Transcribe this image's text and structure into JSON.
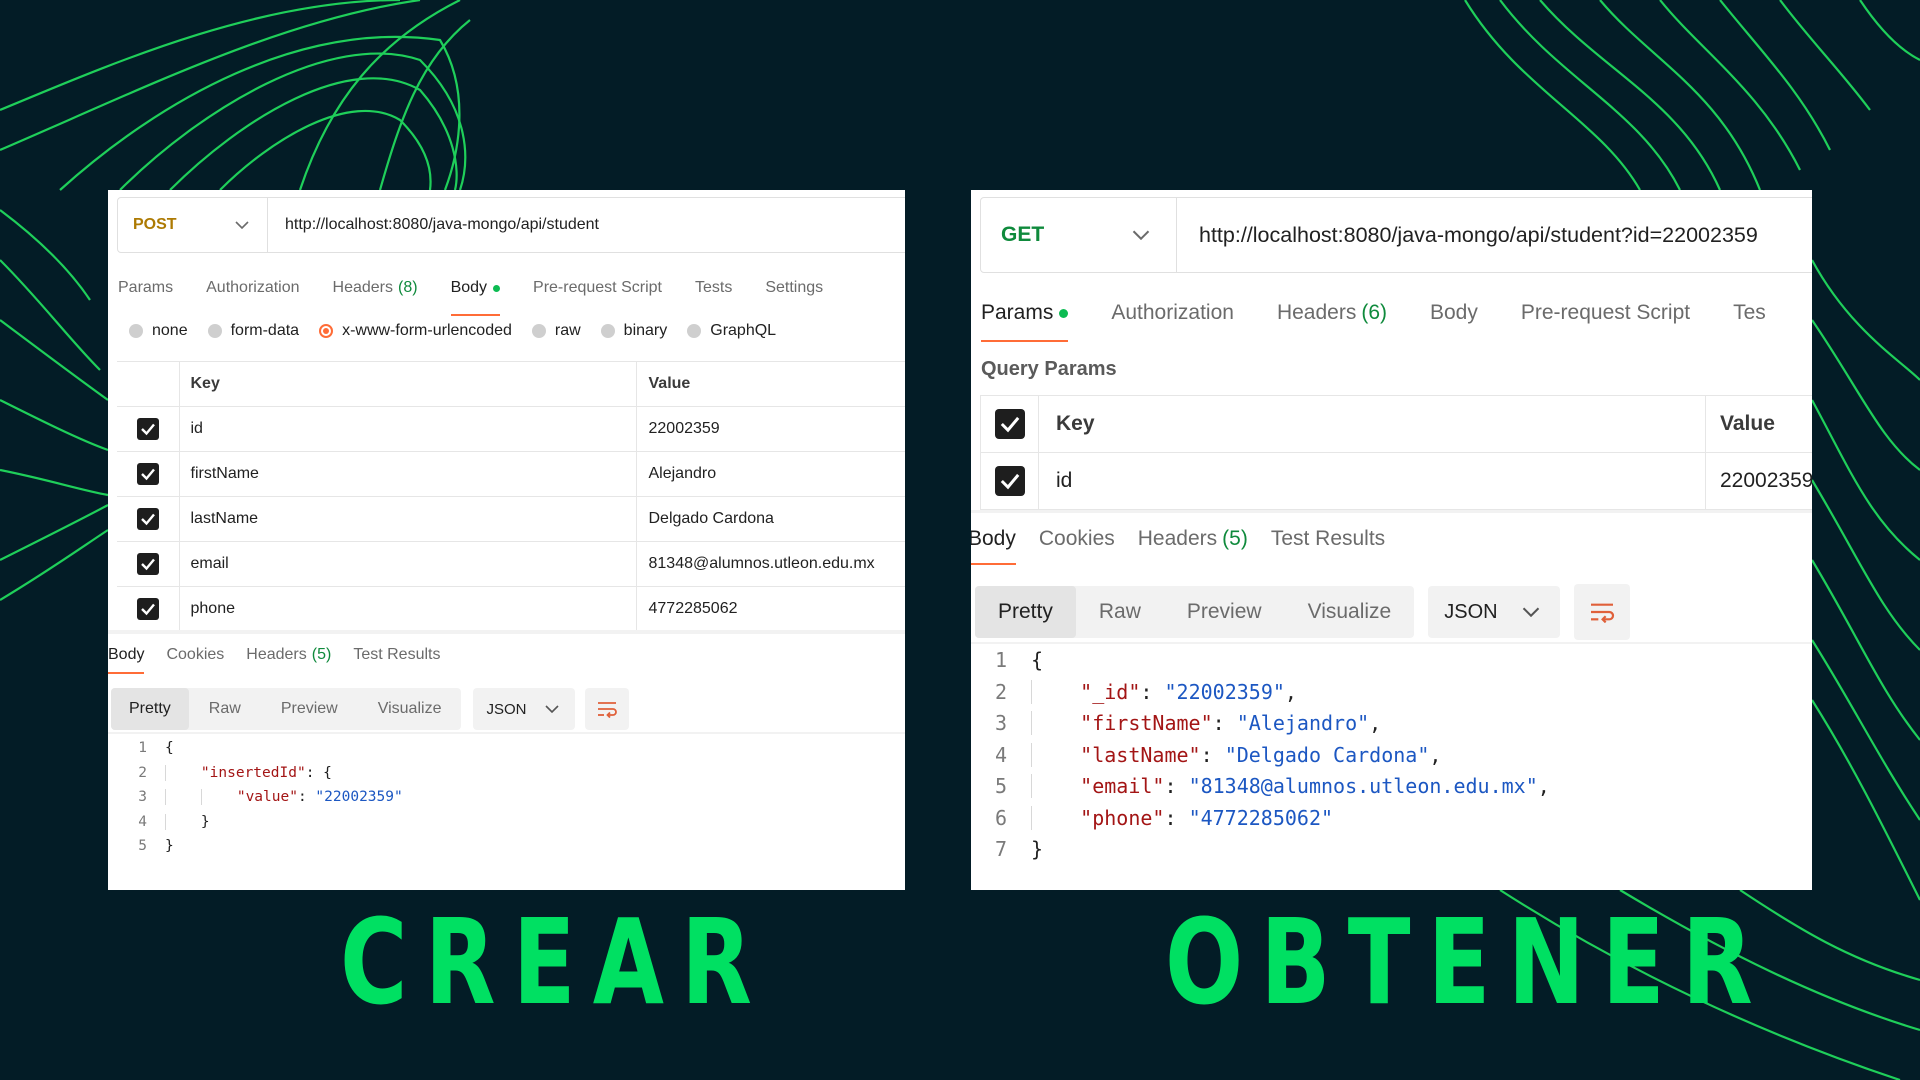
{
  "colors": {
    "background": "#031c26",
    "accent_lines": "#1fcf5a",
    "caption": "#00e062",
    "active_tab_underline": "#ff6c37",
    "post_method": "#ad7a03",
    "get_method": "#0f8a3c"
  },
  "left": {
    "method": "POST",
    "url": "http://localhost:8080/java-mongo/api/student",
    "request_tabs": [
      {
        "label": "Params"
      },
      {
        "label": "Authorization"
      },
      {
        "label": "Headers",
        "count": "(8)"
      },
      {
        "label": "Body"
      },
      {
        "label": "Pre-request Script"
      },
      {
        "label": "Tests"
      },
      {
        "label": "Settings"
      }
    ],
    "body_types": [
      "none",
      "form-data",
      "x-www-form-urlencoded",
      "raw",
      "binary",
      "GraphQL"
    ],
    "body_type_selected": "x-www-form-urlencoded",
    "table": {
      "key_header": "Key",
      "value_header": "Value",
      "rows": [
        {
          "key": "id",
          "value": "22002359"
        },
        {
          "key": "firstName",
          "value": "Alejandro"
        },
        {
          "key": "lastName",
          "value": "Delgado Cardona"
        },
        {
          "key": "email",
          "value": "81348@alumnos.utleon.edu.mx"
        },
        {
          "key": "phone",
          "value": "4772285062"
        }
      ]
    },
    "response_tabs": [
      {
        "label": "Body"
      },
      {
        "label": "Cookies"
      },
      {
        "label": "Headers",
        "count": "(5)"
      },
      {
        "label": "Test Results"
      }
    ],
    "view_modes": [
      "Pretty",
      "Raw",
      "Preview",
      "Visualize"
    ],
    "format": "JSON",
    "code": {
      "line_numbers": [
        "1",
        "2",
        "3",
        "4",
        "5"
      ],
      "open_brace": "{",
      "inserted_key": "\"insertedId\"",
      "value_key": "\"value\"",
      "value": "\"22002359\"",
      "close_inner": "}",
      "close_brace": "}"
    },
    "caption": "CREAR"
  },
  "right": {
    "method": "GET",
    "url": "http://localhost:8080/java-mongo/api/student?id=22002359",
    "request_tabs": [
      {
        "label": "Params"
      },
      {
        "label": "Authorization"
      },
      {
        "label": "Headers",
        "count": "(6)"
      },
      {
        "label": "Body"
      },
      {
        "label": "Pre-request Script"
      },
      {
        "label": "Tes"
      }
    ],
    "query_title": "Query Params",
    "table": {
      "key_header": "Key",
      "value_header": "Value",
      "rows": [
        {
          "key": "id",
          "value": "22002359"
        }
      ]
    },
    "response_tabs": [
      {
        "label": "Body"
      },
      {
        "label": "Cookies"
      },
      {
        "label": "Headers",
        "count": "(5)"
      },
      {
        "label": "Test Results"
      }
    ],
    "view_modes": [
      "Pretty",
      "Raw",
      "Preview",
      "Visualize"
    ],
    "format": "JSON",
    "code": {
      "line_numbers": [
        "1",
        "2",
        "3",
        "4",
        "5",
        "6",
        "7"
      ],
      "open_brace": "{",
      "fields": [
        {
          "key": "\"_id\"",
          "value": "\"22002359\""
        },
        {
          "key": "\"firstName\"",
          "value": "\"Alejandro\""
        },
        {
          "key": "\"lastName\"",
          "value": "\"Delgado Cardona\""
        },
        {
          "key": "\"email\"",
          "value": "\"81348@alumnos.utleon.edu.mx\""
        },
        {
          "key": "\"phone\"",
          "value": "\"4772285062\""
        }
      ],
      "close_brace": "}"
    },
    "caption": "OBTENER"
  }
}
